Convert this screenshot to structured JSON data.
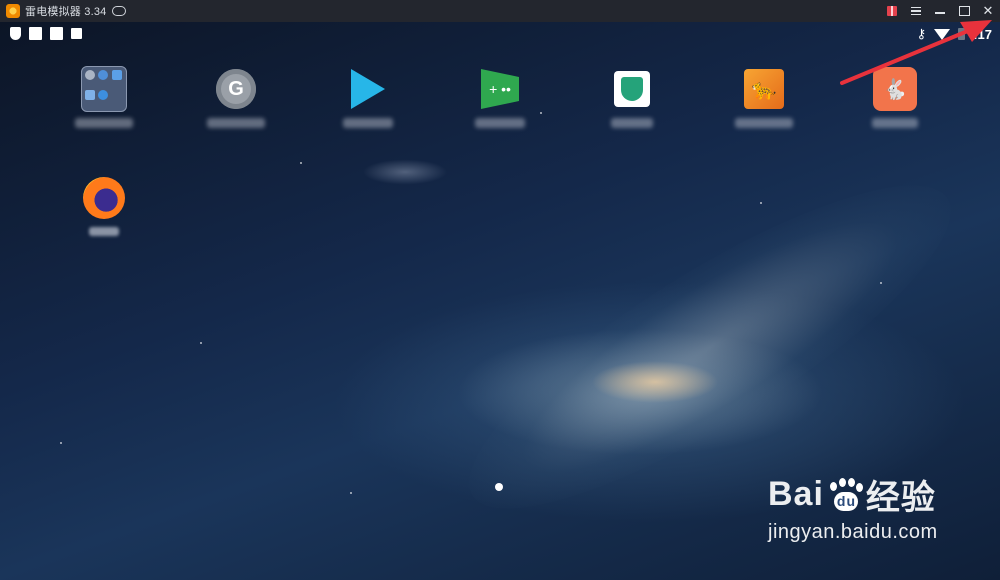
{
  "titlebar": {
    "title": "雷电模拟器 3.34",
    "icons": [
      "app-logo-icon",
      "gamepad-icon",
      "gift-icon",
      "menu-icon",
      "minimize-icon",
      "maximize-icon",
      "close-icon"
    ],
    "close_label": "✕"
  },
  "statusbar": {
    "left_icons": [
      "shield-icon",
      "notification-square-icon",
      "notification-square-icon",
      "notification-square-icon"
    ],
    "right_icons": [
      "vpn-key-icon",
      "wifi-icon",
      "battery-icon"
    ],
    "time": ":17"
  },
  "desktop": {
    "apps_row1": [
      {
        "name": "folder",
        "icon": "folder-icon"
      },
      {
        "name": "settings",
        "icon": "settings-gear-icon",
        "glyph": "G"
      },
      {
        "name": "play-store",
        "icon": "google-play-icon"
      },
      {
        "name": "play-games",
        "icon": "play-games-icon",
        "glyph": "+ ••"
      },
      {
        "name": "vpn",
        "icon": "vpn-shield-icon"
      },
      {
        "name": "cm-browser",
        "icon": "cheetah-icon",
        "glyph": "🐆"
      },
      {
        "name": "rabbit-app",
        "icon": "rabbit-icon",
        "glyph": "🐇"
      }
    ],
    "apps_row2": [
      {
        "name": "firefox",
        "icon": "firefox-icon"
      }
    ],
    "page_indicator": "page-dot"
  },
  "watermark": {
    "brand": "Bai",
    "brand_suffix": "经验",
    "paw_text": "du",
    "url": "jingyan.baidu.com"
  },
  "colors": {
    "titlebar_bg": "#23262e",
    "annotation_arrow": "#e8323c"
  }
}
